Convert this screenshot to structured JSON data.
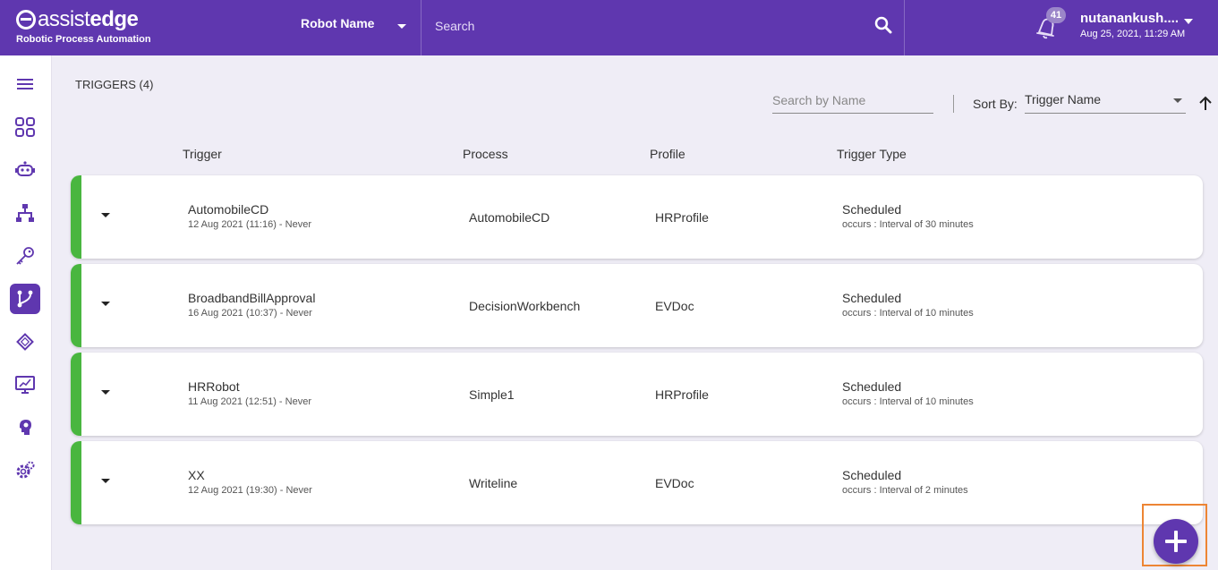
{
  "header": {
    "brand_word1": "assist",
    "brand_word2": "edge",
    "brand_subtitle": "Robotic Process Automation",
    "robot_select_label": "Robot Name",
    "search_placeholder": "Search",
    "notification_count": "41",
    "user_name": "nutanankush....",
    "user_datetime": "Aug 25, 2021, 11:29 AM"
  },
  "sidebar": {
    "items": [
      {
        "icon": "menu-icon",
        "active": false
      },
      {
        "icon": "dashboard-grid-icon",
        "active": false
      },
      {
        "icon": "robot-icon",
        "active": false
      },
      {
        "icon": "hierarchy-icon",
        "active": false
      },
      {
        "icon": "key-icon",
        "active": false
      },
      {
        "icon": "trigger-branch-icon",
        "active": true
      },
      {
        "icon": "chip-icon",
        "active": false
      },
      {
        "icon": "monitor-chart-icon",
        "active": false
      },
      {
        "icon": "brain-head-icon",
        "active": false
      },
      {
        "icon": "settings-gear-icon",
        "active": false
      }
    ]
  },
  "main": {
    "title": "TRIGGERS (4)",
    "name_search_placeholder": "Search by Name",
    "sort_label": "Sort By:",
    "sort_value": "Trigger Name",
    "columns": {
      "trigger": "Trigger",
      "process": "Process",
      "profile": "Profile",
      "trigger_type": "Trigger Type"
    },
    "rows": [
      {
        "name": "AutomobileCD",
        "dates": "12 Aug 2021 (11:16) - Never",
        "process": "AutomobileCD",
        "profile": "HRProfile",
        "type": "Scheduled",
        "occurs": "occurs : Interval of 30 minutes"
      },
      {
        "name": "BroadbandBillApproval",
        "dates": "16 Aug 2021 (10:37) - Never",
        "process": "DecisionWorkbench",
        "profile": "EVDoc",
        "type": "Scheduled",
        "occurs": "occurs : Interval of 10 minutes"
      },
      {
        "name": "HRRobot",
        "dates": "11 Aug 2021 (12:51) - Never",
        "process": "Simple1",
        "profile": "HRProfile",
        "type": "Scheduled",
        "occurs": "occurs : Interval of 10 minutes"
      },
      {
        "name": "XX",
        "dates": "12 Aug 2021 (19:30) - Never",
        "process": "Writeline",
        "profile": "EVDoc",
        "type": "Scheduled",
        "occurs": "occurs : Interval of 2 minutes"
      }
    ]
  },
  "colors": {
    "brand_purple": "#5f37af",
    "status_green": "#49b63f",
    "highlight_orange": "#ed8534",
    "page_background": "#efedf6"
  }
}
